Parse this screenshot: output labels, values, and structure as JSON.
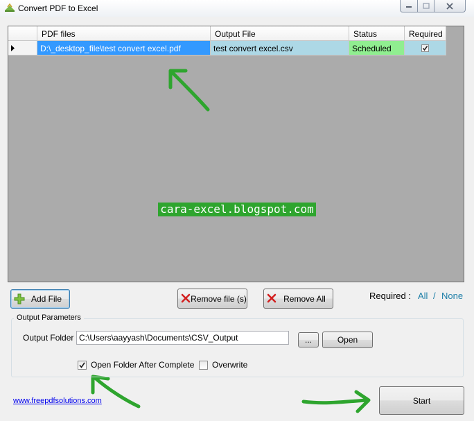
{
  "window": {
    "title": "Convert PDF to Excel"
  },
  "grid": {
    "columns": [
      "PDF files",
      "Output File",
      "Status",
      "Required"
    ],
    "rows": [
      {
        "pdf": "D:\\_desktop_file\\test convert excel.pdf",
        "output": "test convert excel.csv",
        "status": "Scheduled",
        "required": true
      }
    ]
  },
  "watermark": "cara-excel.blogspot.com",
  "buttons": {
    "add_file": "Add File",
    "remove_file": "Remove file (s)",
    "remove_all": "Remove All",
    "browse": "...",
    "open": "Open",
    "start": "Start"
  },
  "required": {
    "label": "Required :",
    "all": "All",
    "separator": "/",
    "none": "None"
  },
  "output_params": {
    "group_title": "Output Parameters",
    "folder_label": "Output Folder",
    "folder_value": "C:\\Users\\aayyash\\Documents\\CSV_Output",
    "open_after_label": "Open Folder After Complete",
    "open_after_checked": true,
    "overwrite_label": "Overwrite",
    "overwrite_checked": false
  },
  "footer": {
    "link": "www.freepdfsolutions.com"
  },
  "icons": {
    "add": "plus-icon",
    "remove": "red-x-icon",
    "row_indicator": "row-pointer-icon",
    "app": "app-icon"
  },
  "colors": {
    "pdf_cell": "#3399ff",
    "output_cell": "#add8e6",
    "status_cell": "#90ee90",
    "watermark": "#2ea52e",
    "annotation_arrow": "#2ea52e"
  }
}
